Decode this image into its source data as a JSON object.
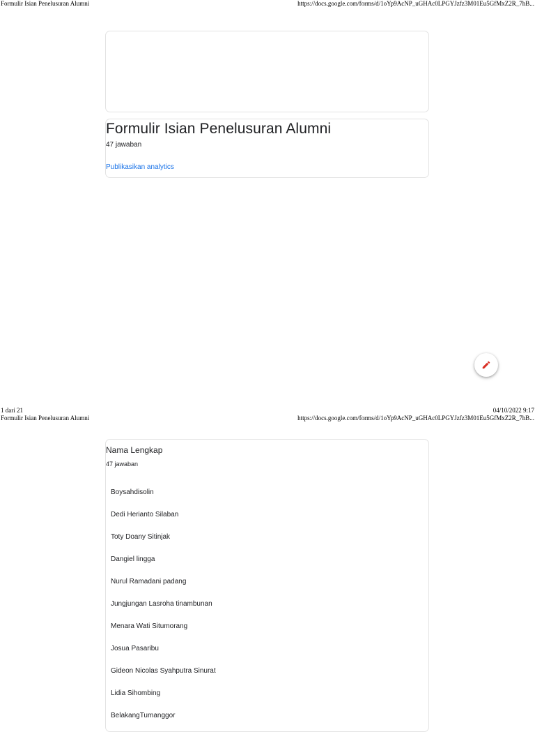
{
  "page1": {
    "header": {
      "title": "Formulir Isian Penelusuran Alumni",
      "url": "https://docs.google.com/forms/d/1oYp9AcNP_uGHAc0LPGYJzfz3M01Eu5GfMxZ2R_7hB..."
    },
    "form": {
      "title": "Formulir Isian Penelusuran Alumni",
      "response_count": "47 jawaban",
      "publish_link": "Publikasikan analytics"
    },
    "fab_icon": "pencil-icon",
    "footer": {
      "page": "1 dari 21",
      "datetime": "04/10/2022 9:17"
    }
  },
  "page2": {
    "header": {
      "title": "Formulir Isian Penelusuran Alumni",
      "url": "https://docs.google.com/forms/d/1oYp9AcNP_uGHAc0LPGYJzfz3M01Eu5GfMxZ2R_7hB..."
    },
    "question": {
      "title": "Nama Lengkap",
      "response_count": "47 jawaban",
      "responses": [
        "Boysahdisolin",
        "Dedi Herianto Silaban",
        "Toty Doany Sitinjak",
        "Dangiel lingga",
        "Nurul Ramadani padang",
        "Jungjungan Lasroha tinambunan",
        "Menara Wati Situmorang",
        "Josua Pasaribu",
        "Gideon Nicolas Syahputra Sinurat",
        "Lidia Sihombing",
        "BelakangTumanggor"
      ]
    }
  },
  "colors": {
    "link": "#1a73e8",
    "fab_icon": "#d93025",
    "card_border": "#e3e3e3"
  }
}
